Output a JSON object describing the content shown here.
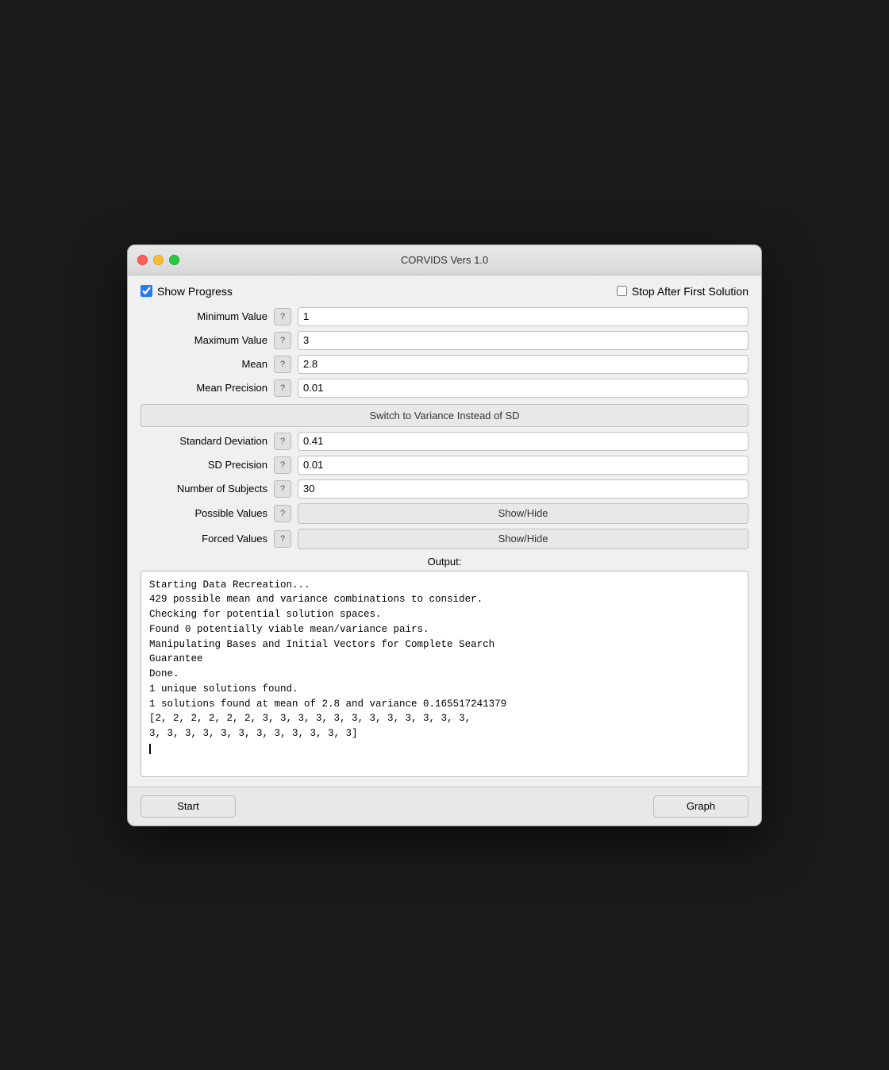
{
  "window": {
    "title": "CORVIDS Vers 1.0"
  },
  "controls": {
    "show_progress_label": "Show Progress",
    "show_progress_checked": true,
    "stop_after_first_label": "Stop After First Solution",
    "stop_after_first_checked": false
  },
  "form": {
    "minimum_value_label": "Minimum Value",
    "minimum_value": "1",
    "maximum_value_label": "Maximum Value",
    "maximum_value": "3",
    "mean_label": "Mean",
    "mean_value": "2.8",
    "mean_precision_label": "Mean Precision",
    "mean_precision_value": "0.01",
    "switch_btn_label": "Switch to Variance Instead of SD",
    "standard_deviation_label": "Standard Deviation",
    "standard_deviation_value": "0.41",
    "sd_precision_label": "SD Precision",
    "sd_precision_value": "0.01",
    "number_of_subjects_label": "Number of Subjects",
    "number_of_subjects_value": "30",
    "possible_values_label": "Possible Values",
    "possible_values_btn": "Show/Hide",
    "forced_values_label": "Forced Values",
    "forced_values_btn": "Show/Hide",
    "help_label": "?"
  },
  "output": {
    "label": "Output:",
    "text": "Starting Data Recreation...\n429 possible mean and variance combinations to consider.\nChecking for potential solution spaces.\nFound 0 potentially viable mean/variance pairs.\nManipulating Bases and Initial Vectors for Complete Search\nGuarantee\nDone.\n1 unique solutions found.\n1 solutions found at mean of 2.8 and variance 0.165517241379\n[2, 2, 2, 2, 2, 2, 3, 3, 3, 3, 3, 3, 3, 3, 3, 3, 3, 3,\n3, 3, 3, 3, 3, 3, 3, 3, 3, 3, 3, 3]"
  },
  "buttons": {
    "start_label": "Start",
    "graph_label": "Graph"
  }
}
